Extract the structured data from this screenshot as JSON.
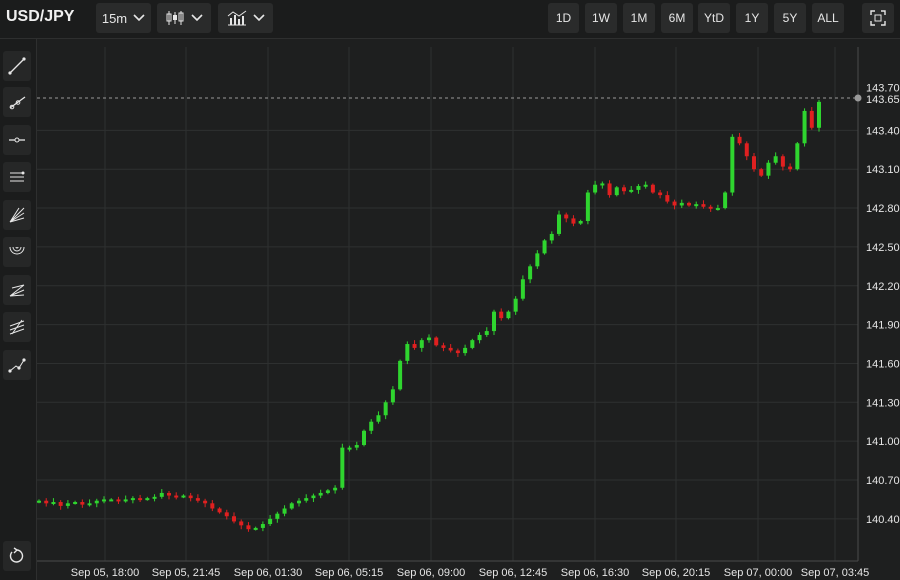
{
  "symbol": "USD/JPY",
  "toolbar": {
    "interval": "15m",
    "chart_type_icon": "candlestick-icon",
    "indicators_icon": "indicators-icon",
    "ranges": [
      "1D",
      "1W",
      "1M",
      "6M",
      "YtD",
      "1Y",
      "5Y",
      "ALL"
    ],
    "fullscreen_icon": "fullscreen-icon"
  },
  "drawing_tools": [
    "trend-line-icon",
    "ray-icon",
    "horizontal-line-icon",
    "parallel-channel-icon",
    "fan-icon",
    "arc-icon",
    "pitchfork-icon",
    "fibonacci-icon",
    "path-icon",
    "reset-icon"
  ],
  "colors": {
    "background": "#1e1f1f",
    "up": "#2fd52f",
    "down": "#e02020",
    "grid": "#2e3030"
  },
  "chart_data": {
    "type": "candlestick",
    "y_tick_labels": [
      "143.70",
      "143.65",
      "143.40",
      "143.10",
      "142.80",
      "142.50",
      "142.20",
      "141.90",
      "141.60",
      "141.30",
      "141.00",
      "140.70",
      "140.40"
    ],
    "y_ticks": [
      143.4,
      143.1,
      142.8,
      142.5,
      142.2,
      141.9,
      141.6,
      141.3,
      141.0,
      140.7,
      140.4
    ],
    "ylim": [
      140.2,
      143.9
    ],
    "x_labels": [
      "Sep 05, 18:00",
      "Sep 05, 21:45",
      "Sep 06, 01:30",
      "Sep 06, 05:15",
      "Sep 06, 09:00",
      "Sep 06, 12:45",
      "Sep 06, 16:30",
      "Sep 06, 20:15",
      "Sep 07, 00:00",
      "Sep 07, 03:45"
    ],
    "last_price": 143.65,
    "high_marker": 143.7,
    "close_series": [
      140.54,
      140.52,
      140.53,
      140.5,
      140.52,
      140.53,
      140.51,
      140.52,
      140.54,
      140.55,
      140.55,
      140.54,
      140.55,
      140.56,
      140.55,
      140.56,
      140.57,
      140.6,
      140.58,
      140.57,
      140.58,
      140.56,
      140.54,
      140.52,
      140.48,
      140.45,
      140.42,
      140.38,
      140.35,
      140.32,
      140.33,
      140.36,
      140.4,
      140.44,
      140.48,
      140.52,
      140.54,
      140.56,
      140.58,
      140.6,
      140.62,
      140.64,
      140.95,
      140.95,
      140.97,
      141.08,
      141.15,
      141.2,
      141.3,
      141.4,
      141.62,
      141.75,
      141.72,
      141.78,
      141.8,
      141.74,
      141.72,
      141.7,
      141.68,
      141.72,
      141.78,
      141.82,
      141.85,
      142.0,
      141.95,
      142.0,
      142.1,
      142.25,
      142.35,
      142.45,
      142.55,
      142.6,
      142.75,
      142.72,
      142.68,
      142.7,
      142.92,
      142.98,
      142.99,
      142.9,
      142.96,
      142.93,
      142.94,
      142.97,
      142.98,
      142.92,
      142.9,
      142.85,
      142.82,
      142.84,
      142.82,
      142.83,
      142.81,
      142.8,
      142.8,
      142.92,
      143.35,
      143.3,
      143.2,
      143.1,
      143.05,
      143.15,
      143.2,
      143.12,
      143.1,
      143.3,
      143.55,
      143.42,
      143.62
    ]
  }
}
